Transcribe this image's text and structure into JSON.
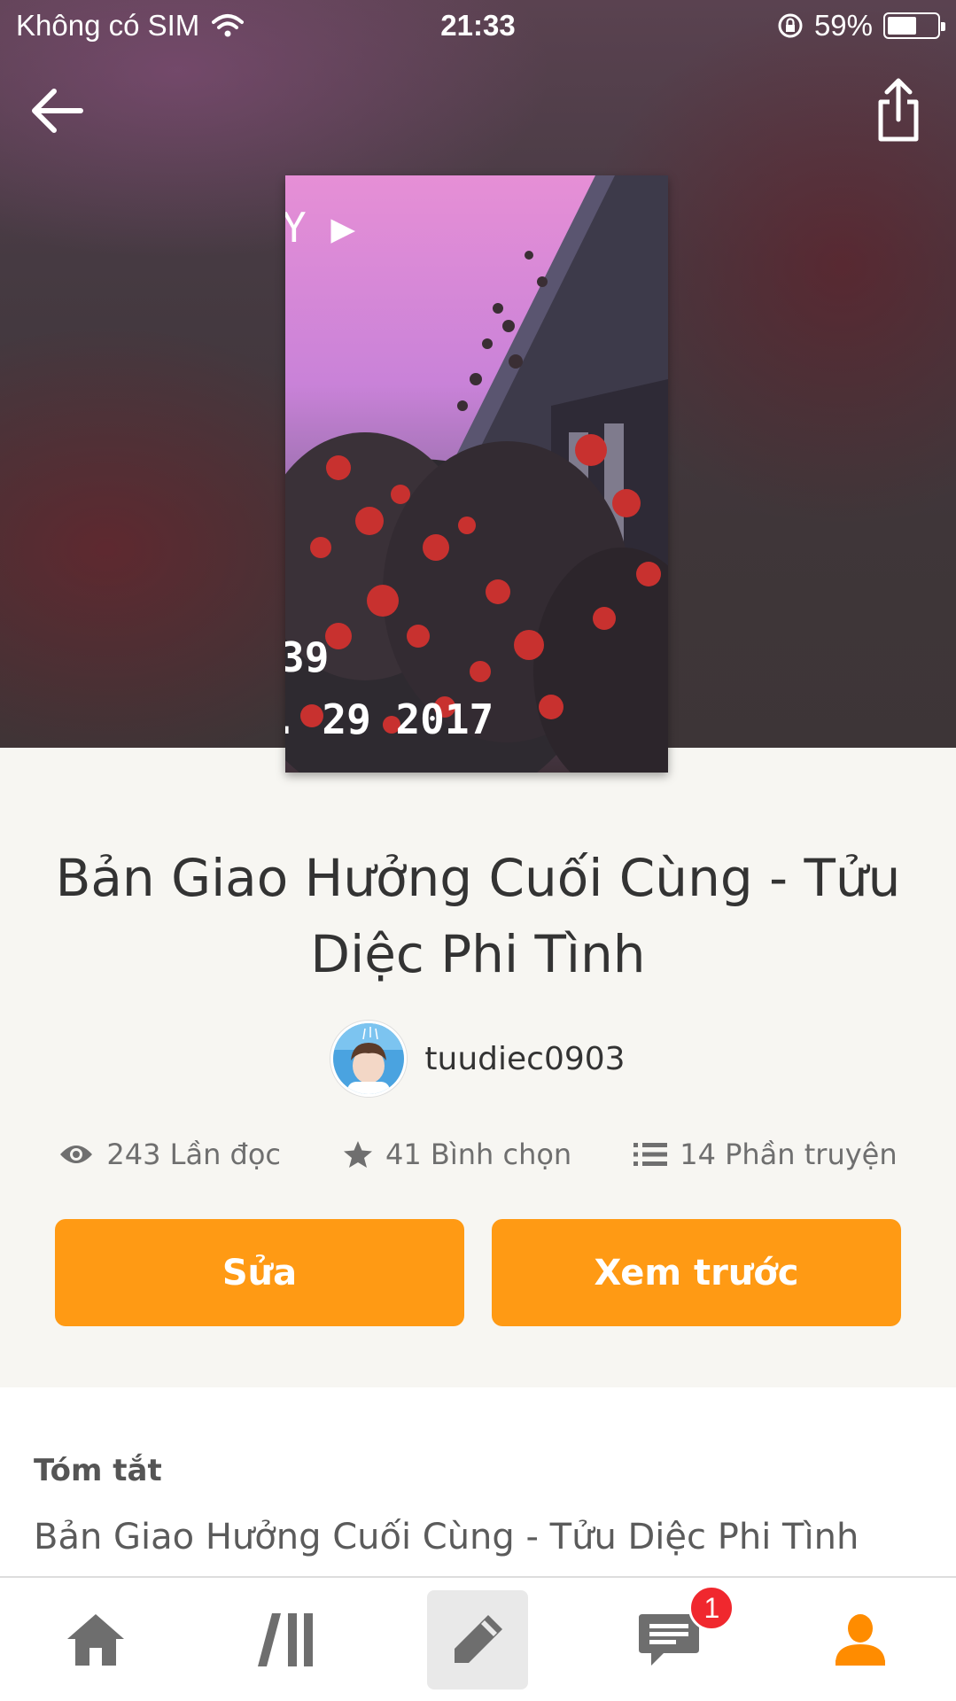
{
  "status_bar": {
    "carrier": "Không có SIM",
    "time": "21:33",
    "battery": "59%",
    "battery_level": 0.59
  },
  "nav": {
    "back_icon": "arrow-left-icon",
    "share_icon": "share-icon"
  },
  "cover": {
    "overlay_top": "Y ▶",
    "overlay_line1": "39",
    "overlay_line2": ". 29 2017"
  },
  "story": {
    "title": "Bản Giao Hưởng Cuối Cùng - Tửu Diệc Phi Tình",
    "author": "tuudiec0903"
  },
  "stats": {
    "reads": "243 Lần đọc",
    "votes": "41 Bình chọn",
    "parts": "14 Phần truyện"
  },
  "actions": {
    "edit_label": "Sửa",
    "preview_label": "Xem trước"
  },
  "summary": {
    "heading": "Tóm tắt",
    "text": "Bản Giao Hưởng Cuối Cùng - Tửu Diệc Phi Tình"
  },
  "tabbar": {
    "items": [
      "home-icon",
      "library-icon",
      "write-icon",
      "messages-icon",
      "profile-icon"
    ],
    "messages_badge": "1",
    "active": "write-icon",
    "accent": "#ff9a14"
  },
  "colors": {
    "button": "#ff9a14",
    "badge": "#f0282e",
    "tab_icon": "#6e6e6e"
  }
}
